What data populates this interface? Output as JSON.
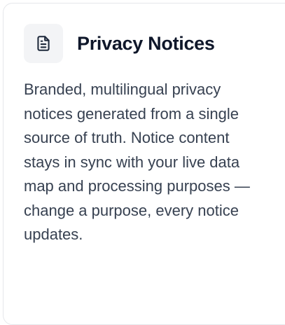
{
  "card": {
    "icon": "document-text-icon",
    "title": "Privacy Notices",
    "description": "Branded, multilingual privacy notices generated from a single source of truth. Notice content stays in sync with your live data map and processing purposes — change a purpose, every notice updates."
  },
  "colors": {
    "icon_stroke": "#1e293b",
    "icon_tile_bg": "#f3f4f6",
    "title": "#0f172a",
    "body_text": "#374151",
    "card_border": "#e5e7eb"
  }
}
